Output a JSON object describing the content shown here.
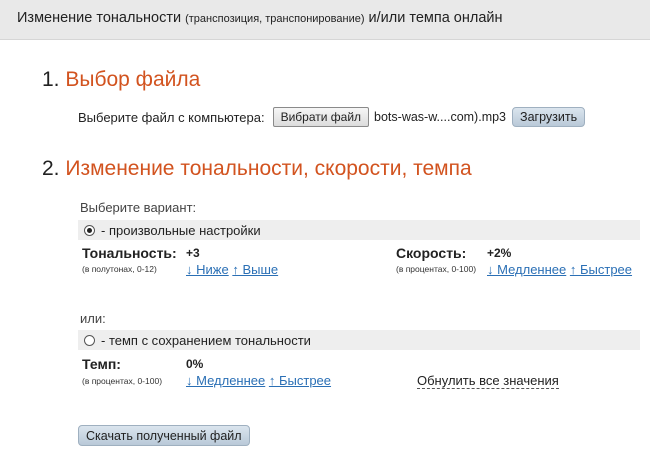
{
  "header": {
    "title_main": "Изменение тональности",
    "title_small": "(транспозиция, транспонирование)",
    "title_tail": "и/или темпа онлайн"
  },
  "step1": {
    "number": "1.",
    "title": "Выбор файла",
    "choose_label": "Выберите файл с компьютера:",
    "browse_button": "Вибрати файл",
    "file_name": "bots-was-w....com).mp3",
    "upload_button": "Загрузить"
  },
  "step2": {
    "number": "2.",
    "title": "Изменение тональности, скорости, темпа",
    "choose_variant": "Выберите вариант:",
    "option_custom": "- произвольные настройки",
    "option_custom_selected": true,
    "pitch": {
      "label": "Тональность:",
      "sub": "(в полутонах, 0-12)",
      "value": "+3",
      "lower": "↓ Ниже",
      "higher": "↑ Выше"
    },
    "speed": {
      "label": "Скорость:",
      "sub": "(в процентах, 0-100)",
      "value": "+2%",
      "slower": "↓ Медленнее",
      "faster": "↑ Быстрее"
    },
    "or_label": "или:",
    "option_tempo": "- темп с сохранением тональности",
    "option_tempo_selected": false,
    "tempo": {
      "label": "Темп:",
      "sub": "(в процентах, 0-100)",
      "value": "0%",
      "slower": "↓ Медленнее",
      "faster": "↑ Быстрее"
    },
    "reset": "Обнулить все значения",
    "download_button": "Скачать полученный файл"
  },
  "colors": {
    "accent": "#d2531f",
    "link": "#2a6fb5",
    "button_blue": "#c7d4e1",
    "option_bar": "#eeeeee",
    "header_bg": "#e9e9e9"
  }
}
